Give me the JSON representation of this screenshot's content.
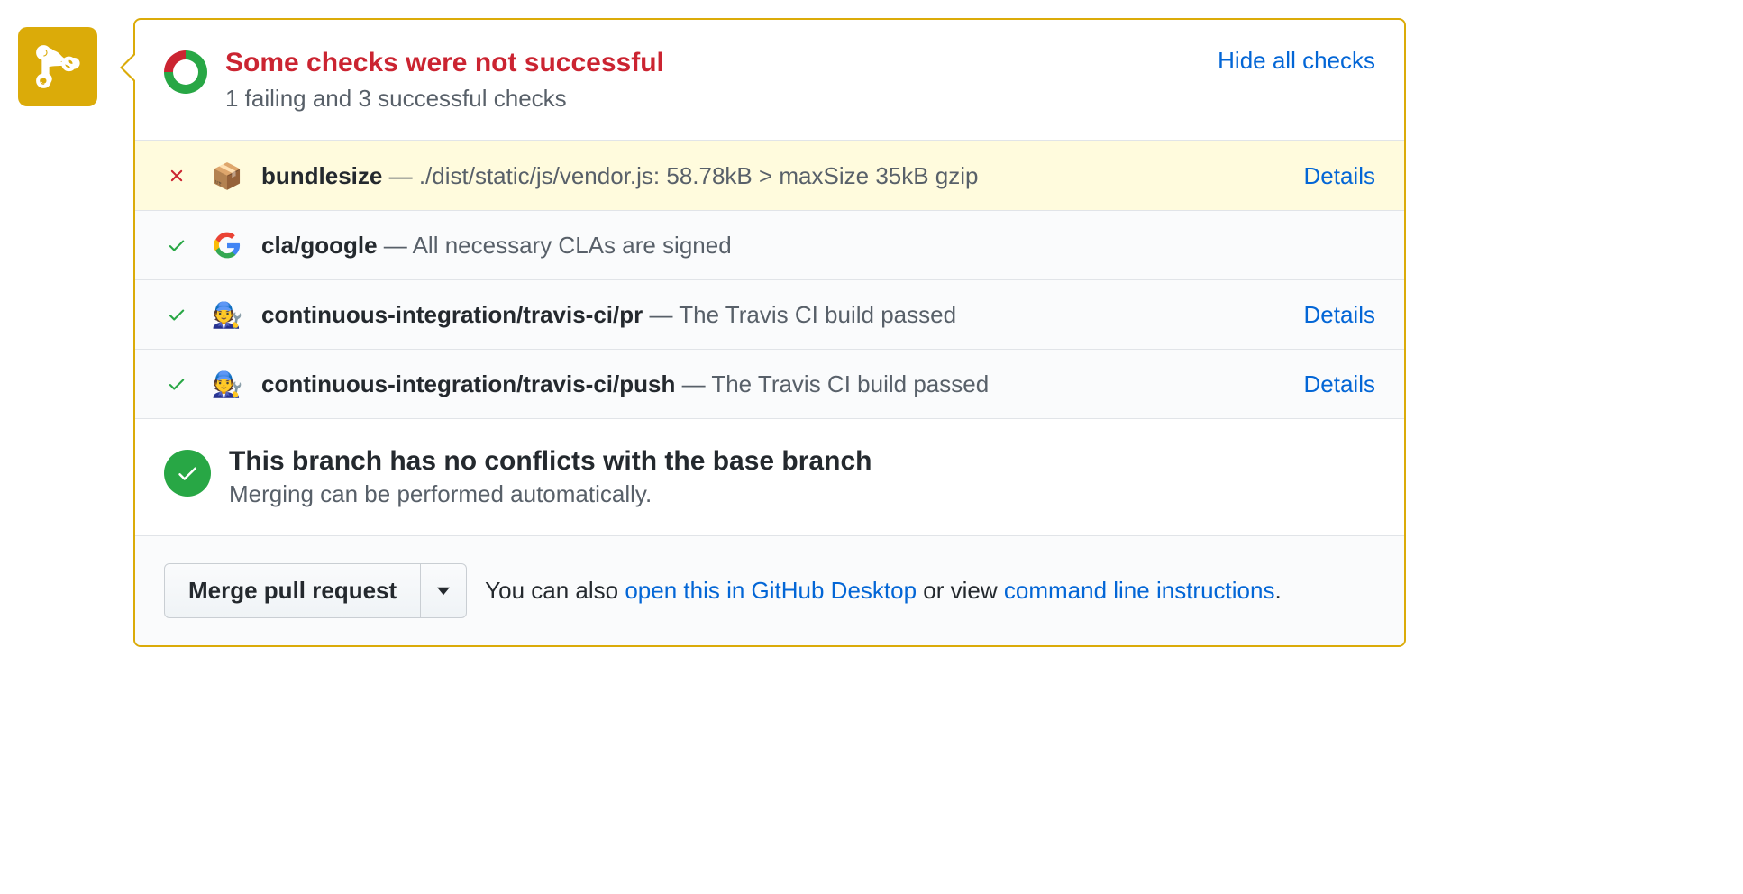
{
  "header": {
    "title": "Some checks were not successful",
    "subtitle": "1 failing and 3 successful checks",
    "toggle": "Hide all checks"
  },
  "checks": [
    {
      "status": "fail",
      "avatar": "📦",
      "name": "bundlesize",
      "desc": "./dist/static/js/vendor.js: 58.78kB > maxSize 35kB gzip",
      "details": "Details"
    },
    {
      "status": "pass",
      "avatar": "G",
      "name": "cla/google",
      "desc": "All necessary CLAs are signed",
      "details": ""
    },
    {
      "status": "pass",
      "avatar": "🧑‍🔧",
      "name": "continuous-integration/travis-ci/pr",
      "desc": "The Travis CI build passed",
      "details": "Details"
    },
    {
      "status": "pass",
      "avatar": "🧑‍🔧",
      "name": "continuous-integration/travis-ci/push",
      "desc": "The Travis CI build passed",
      "details": "Details"
    }
  ],
  "merge": {
    "title": "This branch has no conflicts with the base branch",
    "subtitle": "Merging can be performed automatically."
  },
  "actions": {
    "button": "Merge pull request",
    "desc_prefix": "You can also ",
    "link1": "open this in GitHub Desktop",
    "desc_mid": " or view ",
    "link2": "command line instructions",
    "desc_suffix": "."
  }
}
